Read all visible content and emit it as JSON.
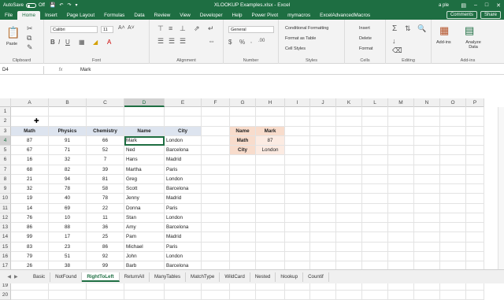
{
  "titlebar": {
    "autosave": "AutoSave",
    "autosave_state": "Off",
    "title": "XLOOKUP Examples.xlsx  -  Excel",
    "user": "a ple"
  },
  "tabs": [
    "File",
    "Home",
    "Insert",
    "Page Layout",
    "Formulas",
    "Data",
    "Review",
    "View",
    "Developer",
    "Help",
    "Power Pivot",
    "mymacros",
    "ExcelAdvancedMacros"
  ],
  "active_tab": "Home",
  "tab_buttons": {
    "comments": "Comments",
    "share": "Share"
  },
  "ribbon": {
    "clipboard": {
      "label": "Clipboard",
      "paste": "Paste"
    },
    "font": {
      "label": "Font",
      "name": "Calibri",
      "size": "11"
    },
    "alignment": {
      "label": "Alignment"
    },
    "number": {
      "label": "Number",
      "format": "General"
    },
    "styles": {
      "label": "Styles",
      "conditional": "Conditional Formatting",
      "table": "Format as Table",
      "cell": "Cell Styles"
    },
    "cells": {
      "label": "Cells",
      "insert": "Insert",
      "delete": "Delete",
      "format": "Format"
    },
    "editing": {
      "label": "Editing"
    },
    "addins": {
      "label": "Add-ins",
      "btn": "Add-ins",
      "analyze": "Analyze Data"
    }
  },
  "formula_bar": {
    "name_box": "D4",
    "fx": "fx",
    "content": "Mark"
  },
  "columns": [
    "A",
    "B",
    "C",
    "D",
    "E",
    "F",
    "G",
    "H",
    "I",
    "J",
    "K",
    "L",
    "M",
    "N",
    "O",
    "P"
  ],
  "rows": [
    "1",
    "2",
    "3",
    "4",
    "5",
    "6",
    "7",
    "8",
    "9",
    "10",
    "11",
    "12",
    "13",
    "14",
    "15",
    "16",
    "17",
    "18",
    "19",
    "20"
  ],
  "table": {
    "headers": [
      "Math",
      "Physics",
      "Chemistry",
      "Name",
      "City"
    ],
    "data": [
      [
        "87",
        "91",
        "66",
        "Mark",
        "London"
      ],
      [
        "67",
        "71",
        "52",
        "Ned",
        "Barcelona"
      ],
      [
        "16",
        "32",
        "7",
        "Hans",
        "Madrid"
      ],
      [
        "68",
        "82",
        "39",
        "Martha",
        "Paris"
      ],
      [
        "21",
        "94",
        "81",
        "Greg",
        "London"
      ],
      [
        "32",
        "78",
        "58",
        "Scott",
        "Barcelona"
      ],
      [
        "19",
        "40",
        "78",
        "Jenny",
        "Madrid"
      ],
      [
        "14",
        "69",
        "22",
        "Donna",
        "Paris"
      ],
      [
        "76",
        "10",
        "11",
        "Stan",
        "London"
      ],
      [
        "86",
        "88",
        "36",
        "Amy",
        "Barcelona"
      ],
      [
        "99",
        "17",
        "25",
        "Pam",
        "Madrid"
      ],
      [
        "83",
        "23",
        "86",
        "Michael",
        "Paris"
      ],
      [
        "79",
        "51",
        "92",
        "John",
        "London"
      ],
      [
        "26",
        "38",
        "99",
        "Barb",
        "Barcelona"
      ]
    ]
  },
  "lookup": {
    "headers": [
      "Name",
      "Mark"
    ],
    "rows": [
      [
        "Math",
        "87"
      ],
      [
        "City",
        "London"
      ]
    ]
  },
  "sheet_tabs": [
    "Basic",
    "NotFound",
    "RightToLeft",
    "ReturnAll",
    "ManyTables",
    "MatchType",
    "WildCard",
    "Nested",
    "hlookup",
    "Countif"
  ],
  "active_sheet": "RightToLeft"
}
